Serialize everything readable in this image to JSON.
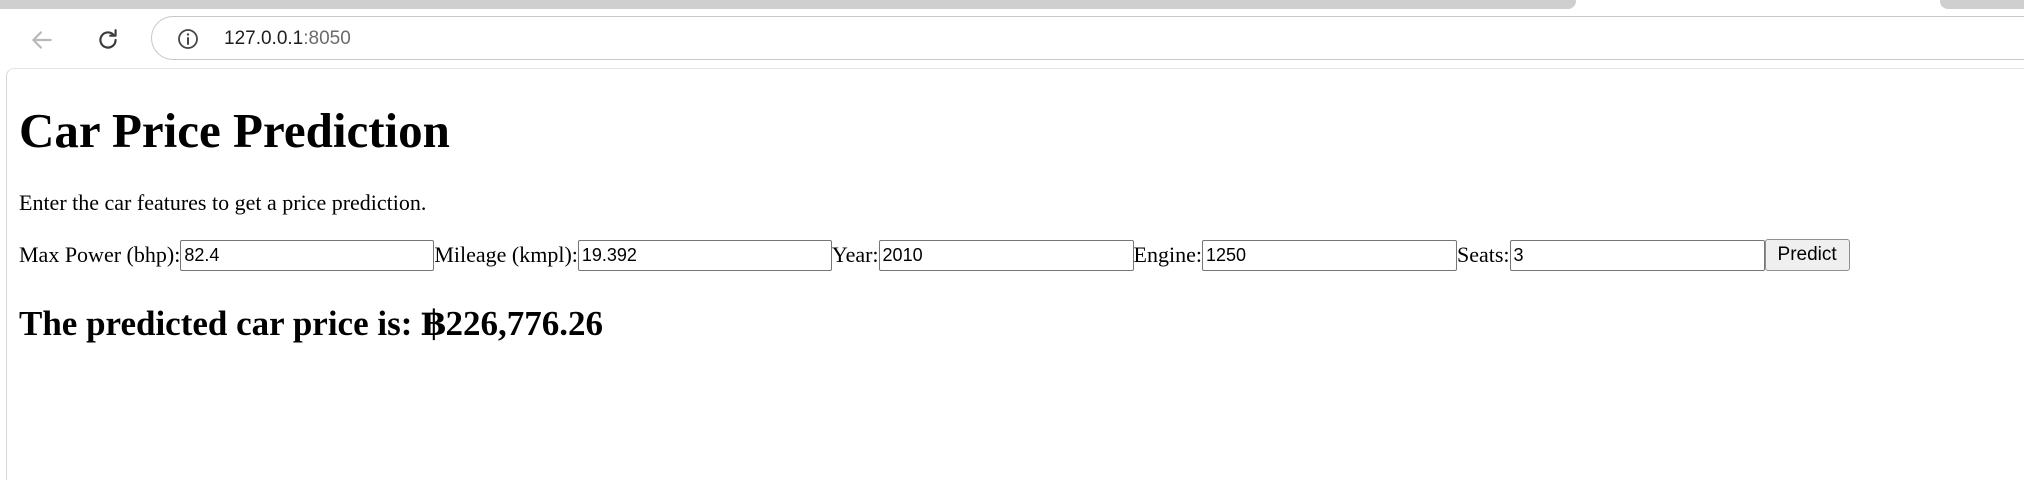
{
  "browser": {
    "url_host": "127.0.0.1",
    "url_port": ":8050",
    "back_icon": "arrow-left-icon",
    "reload_icon": "reload-icon",
    "site_info_icon": "info-circle-icon"
  },
  "page": {
    "title": "Car Price Prediction",
    "intro": "Enter the car features to get a price prediction.",
    "form": {
      "max_power_label": "Max Power (bhp):",
      "max_power_value": "82.4",
      "mileage_label": "Mileage (kmpl):",
      "mileage_value": "19.392",
      "year_label": "Year:",
      "year_value": "2010",
      "engine_label": "Engine:",
      "engine_value": "1250",
      "seats_label": "Seats:",
      "seats_value": "3",
      "predict_label": "Predict"
    },
    "result_text": "The predicted car price is: ฿226,776.26"
  }
}
